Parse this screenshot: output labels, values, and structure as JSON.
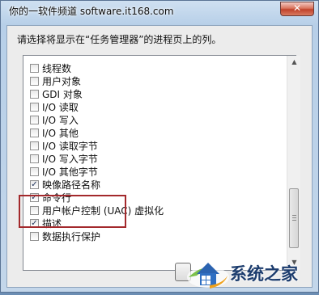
{
  "window": {
    "title": "你的一软件频道 software.it168.com",
    "close_glyph": "✕"
  },
  "dialog": {
    "prompt": "请选择将显示在“任务管理器”的进程页上的列。",
    "columns": [
      {
        "label": "线程数",
        "checked": false
      },
      {
        "label": "用户对象",
        "checked": false
      },
      {
        "label": "GDI 对象",
        "checked": false
      },
      {
        "label": "I/O 读取",
        "checked": false
      },
      {
        "label": "I/O 写入",
        "checked": false
      },
      {
        "label": "I/O 其他",
        "checked": false
      },
      {
        "label": "I/O 读取字节",
        "checked": false
      },
      {
        "label": "I/O 写入字节",
        "checked": false
      },
      {
        "label": "I/O 其他字节",
        "checked": false
      },
      {
        "label": "映像路径名称",
        "checked": true
      },
      {
        "label": "命令行",
        "checked": true
      },
      {
        "label": "用户帐户控制 (UAC) 虚拟化",
        "checked": false
      },
      {
        "label": "描述",
        "checked": true
      },
      {
        "label": "数据执行保护",
        "checked": false
      }
    ]
  },
  "icons": {
    "check": "✓",
    "scroll_up": "▲",
    "scroll_down": "▼"
  },
  "watermark": {
    "text": "系统之家"
  },
  "colors": {
    "highlight": "#a3292c"
  }
}
